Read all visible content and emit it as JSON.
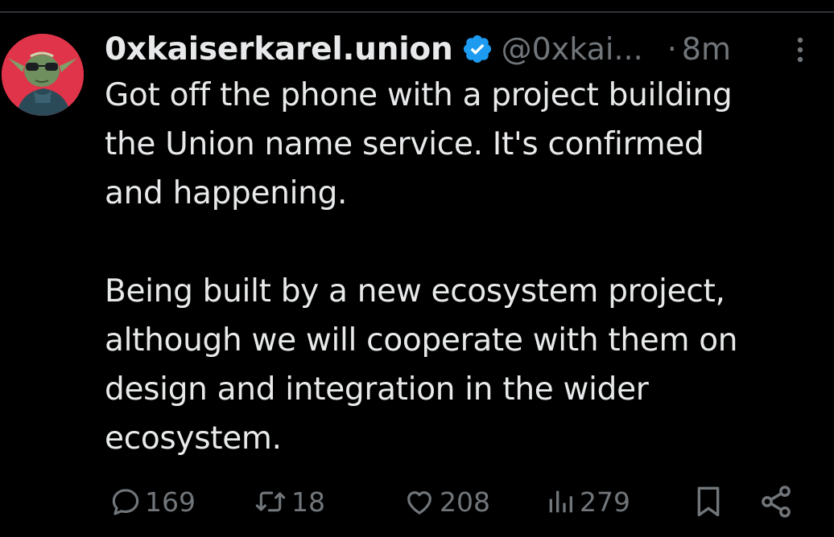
{
  "tweet": {
    "display_name": "0xkaiserkarel.union",
    "handle": "@0xkai...",
    "separator": "·",
    "timestamp": "8m",
    "text_lines": [
      "Got off the phone with a project building",
      "the Union name service. It's confirmed",
      "and happening.",
      "",
      "Being built by a new ecosystem project,",
      "although we will cooperate with them on",
      "design and integration in the wider",
      "ecosystem."
    ]
  },
  "actions": {
    "replies": "169",
    "reposts": "18",
    "likes": "208",
    "views": "279"
  },
  "icons": {
    "verified": "verified-badge-icon",
    "more": "more-dots-icon",
    "reply": "reply-icon",
    "repost": "repost-icon",
    "like": "heart-icon",
    "views": "views-icon",
    "bookmark": "bookmark-icon",
    "share": "share-icon"
  },
  "colors": {
    "background": "#000000",
    "text_primary": "#e7e9ea",
    "text_secondary": "#71767b",
    "verified_blue": "#1d9bf0",
    "avatar_bg": "#e0344a"
  }
}
